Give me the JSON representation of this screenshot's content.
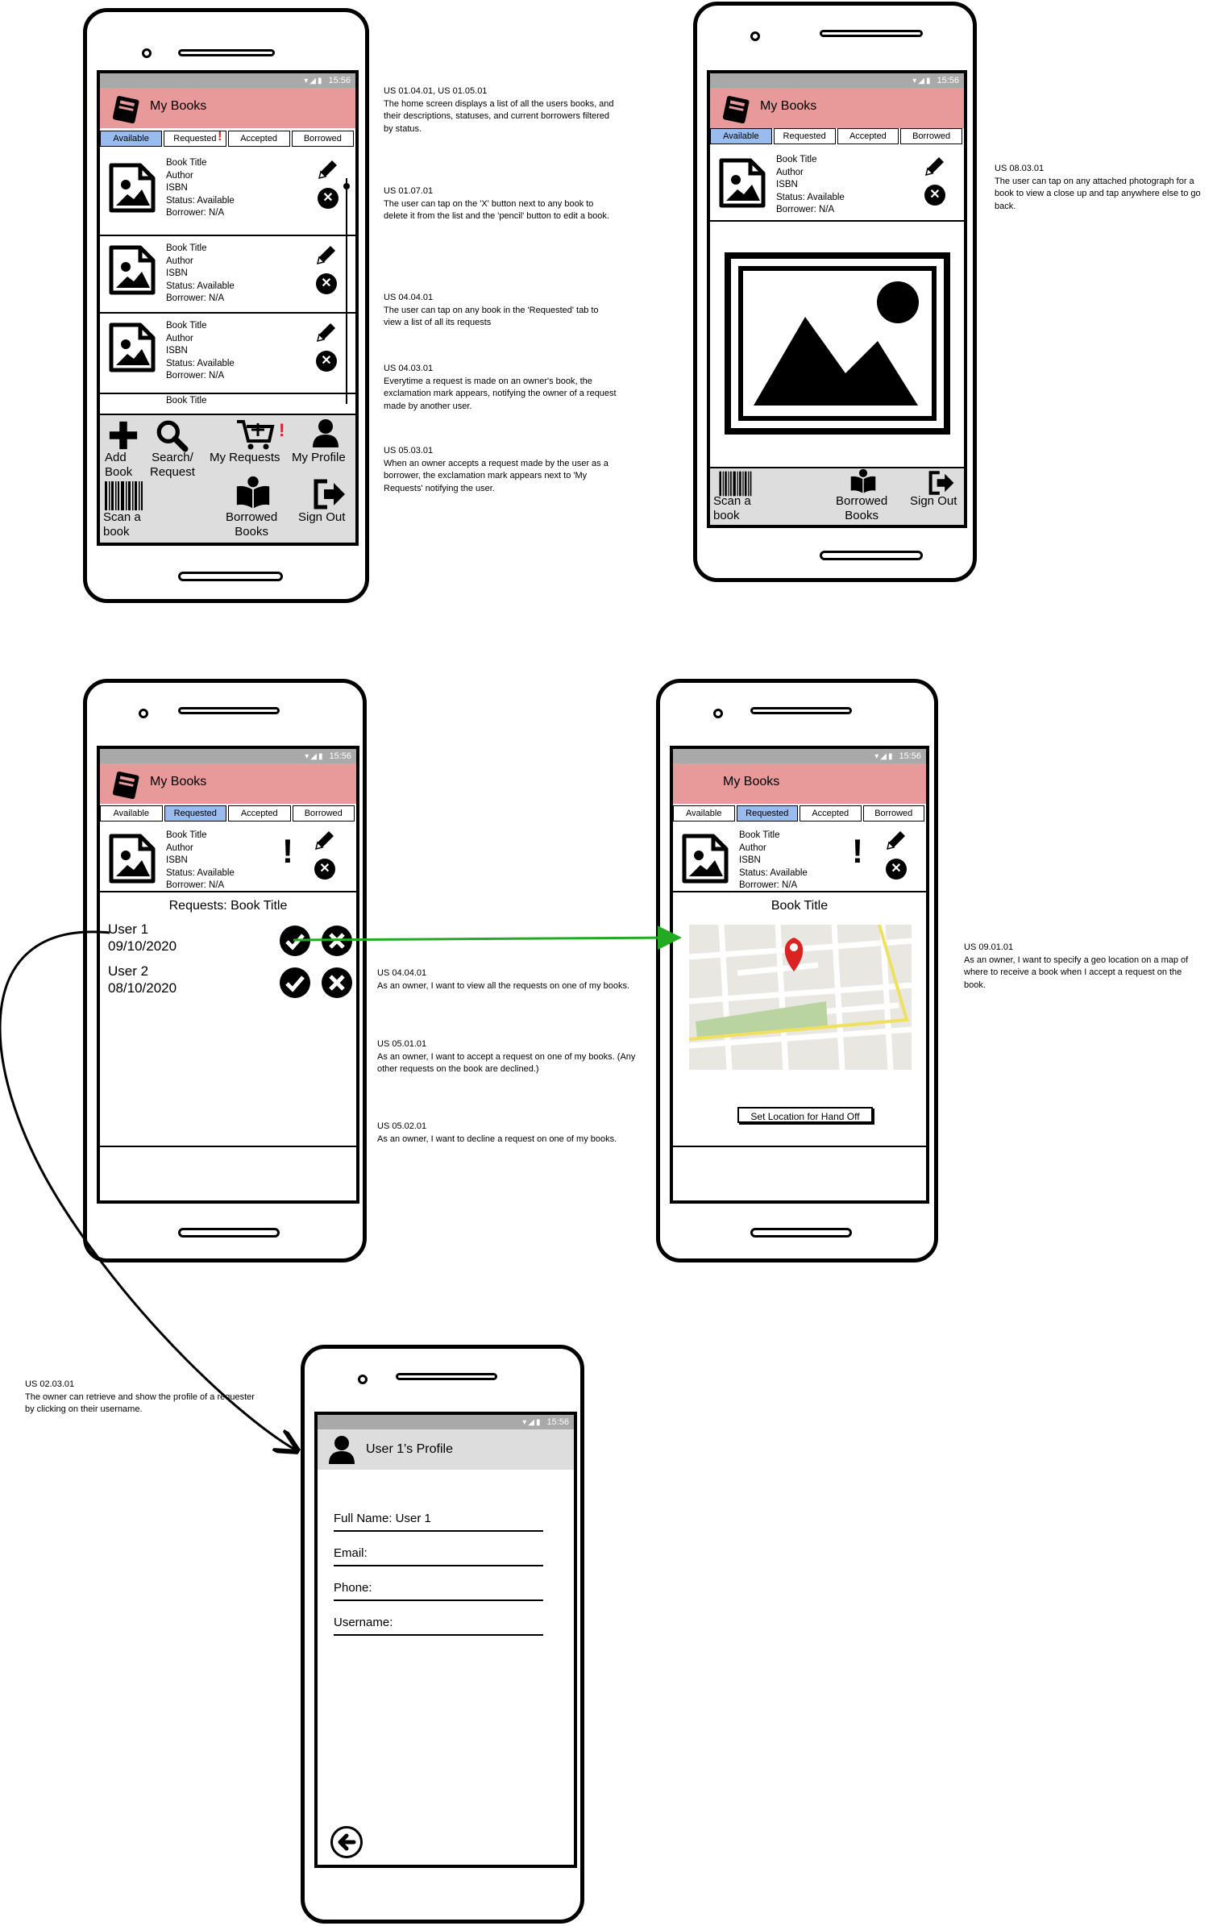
{
  "status": {
    "time": "15:56"
  },
  "phone1": {
    "title": "My Books",
    "tabs": [
      "Available",
      "Requested",
      "Accepted",
      "Borrowed"
    ],
    "active_tab": 0,
    "books": [
      {
        "title": "Book Title",
        "author": "Author",
        "isbn": "ISBN",
        "status": "Status: Available",
        "borrower": "Borrower: N/A"
      },
      {
        "title": "Book Title",
        "author": "Author",
        "isbn": "ISBN",
        "status": "Status: Available",
        "borrower": "Borrower: N/A"
      },
      {
        "title": "Book Title",
        "author": "Author",
        "isbn": "ISBN",
        "status": "Status: Available",
        "borrower": "Borrower: N/A"
      }
    ],
    "partial_book_title": "Book Title",
    "nav": {
      "add_book": "Add\nBook",
      "search": "Search/\nRequest",
      "my_requests": "My Requests",
      "my_profile": "My Profile",
      "scan": "Scan a\nbook",
      "borrowed": "Borrowed\nBooks",
      "sign_out": "Sign Out"
    }
  },
  "phone2": {
    "title": "My Books",
    "tabs": [
      "Available",
      "Requested",
      "Accepted",
      "Borrowed"
    ],
    "active_tab": 0,
    "book": {
      "title": "Book Title",
      "author": "Author",
      "isbn": "ISBN",
      "status": "Status: Available",
      "borrower": "Borrower: N/A"
    },
    "nav": {
      "scan": "Scan a\nbook",
      "borrowed": "Borrowed\nBooks",
      "sign_out": "Sign Out"
    }
  },
  "phone3": {
    "title": "My Books",
    "tabs": [
      "Available",
      "Requested",
      "Accepted",
      "Borrowed"
    ],
    "active_tab": 1,
    "book": {
      "title": "Book Title",
      "author": "Author",
      "isbn": "ISBN",
      "status": "Status: Available",
      "borrower": "Borrower: N/A"
    },
    "requests_title": "Requests: Book Title",
    "requests": [
      {
        "user": "User 1",
        "date": "09/10/2020"
      },
      {
        "user": "User 2",
        "date": "08/10/2020"
      }
    ]
  },
  "phone4": {
    "title": "My Books",
    "tabs": [
      "Available",
      "Requested",
      "Accepted",
      "Borrowed"
    ],
    "active_tab": 1,
    "book": {
      "title": "Book Title",
      "author": "Author",
      "isbn": "ISBN",
      "status": "Status: Available",
      "borrower": "Borrower: N/A"
    },
    "map_title": "Book Title",
    "set_location_button": "Set Location for Hand Off"
  },
  "phone5": {
    "title": "User 1's Profile",
    "fields": [
      "Full Name: User 1",
      "Email:",
      "Phone:",
      "Username:"
    ]
  },
  "notes": {
    "n1": {
      "id": "US 01.04.01, US 01.05.01",
      "text": "The home screen displays a list of all the users books, and their descriptions, statuses, and current borrowers filtered by status."
    },
    "n2": {
      "id": "US 01.07.01",
      "text": "The user can tap on the 'X' button next to any book to delete it from the list and the 'pencil' button to edit a book."
    },
    "n3": {
      "id": "US 04.04.01",
      "text": "The user can tap on any book in the 'Requested' tab to view a list of all its requests"
    },
    "n4": {
      "id": "US 04.03.01",
      "text": "Everytime a request is made on an owner's book, the exclamation mark appears, notifying the owner of a request made by another user."
    },
    "n5": {
      "id": "US 05.03.01",
      "text": "When an owner accepts a request made by the user as a borrower, the exclamation mark appears next to 'My Requests' notifying the user."
    },
    "n6": {
      "id": "US 08.03.01",
      "text": "The user can tap on any attached photograph for a book to view a close up and tap anywhere else to go back."
    },
    "n7": {
      "id": "US 04.04.01",
      "text": "As an owner, I want to view all the requests on one of my books."
    },
    "n8": {
      "id": "US 05.01.01",
      "text": "As an owner, I want to accept a request on one of my books. (Any other requests on the book are declined.)"
    },
    "n9": {
      "id": "US 05.02.01",
      "text": "As an owner, I want to decline a request on one of my books."
    },
    "n10": {
      "id": "US 09.01.01",
      "text": "As an owner, I want to specify a geo location on a map of where to receive a book when I accept a request on the book."
    },
    "n11": {
      "id": "US 02.03.01",
      "text": "The owner can retrieve and show the profile of a requester by clicking on their username."
    }
  },
  "colors": {
    "header": "#e8999a",
    "active_tab": "#99bbee",
    "status_bar": "#a9a9a9",
    "arrow_green": "#22aa22",
    "alert_red": "#dd2222"
  }
}
